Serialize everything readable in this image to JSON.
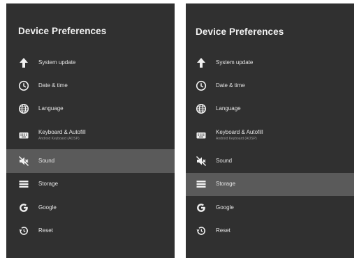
{
  "screens": [
    {
      "title": "Device Preferences",
      "selected": "Sound",
      "items": [
        {
          "label": "System update",
          "icon": "arrow-up-icon"
        },
        {
          "label": "Date & time",
          "icon": "clock-icon"
        },
        {
          "label": "Language",
          "icon": "globe-icon"
        },
        {
          "label": "Keyboard & Autofill",
          "sub": "Android Keyboard (AOSP)",
          "icon": "keyboard-icon"
        },
        {
          "label": "Sound",
          "icon": "sound-off-icon"
        },
        {
          "label": "Storage",
          "icon": "storage-icon"
        },
        {
          "label": "Google",
          "icon": "google-icon"
        },
        {
          "label": "Reset",
          "icon": "history-icon"
        }
      ]
    },
    {
      "title": "Device Preferences",
      "selected": "Storage",
      "items": [
        {
          "label": "System update",
          "icon": "arrow-up-icon"
        },
        {
          "label": "Date & time",
          "icon": "clock-icon"
        },
        {
          "label": "Language",
          "icon": "globe-icon"
        },
        {
          "label": "Keyboard & Autofill",
          "sub": "Android Keyboard (AOSP)",
          "icon": "keyboard-icon"
        },
        {
          "label": "Sound",
          "icon": "sound-off-icon"
        },
        {
          "label": "Storage",
          "icon": "storage-icon"
        },
        {
          "label": "Google",
          "icon": "google-icon"
        },
        {
          "label": "Reset",
          "icon": "history-icon"
        }
      ]
    }
  ],
  "colors": {
    "panel": "#303030",
    "selected": "#5a5a5a",
    "text": "#e6e6e6"
  }
}
